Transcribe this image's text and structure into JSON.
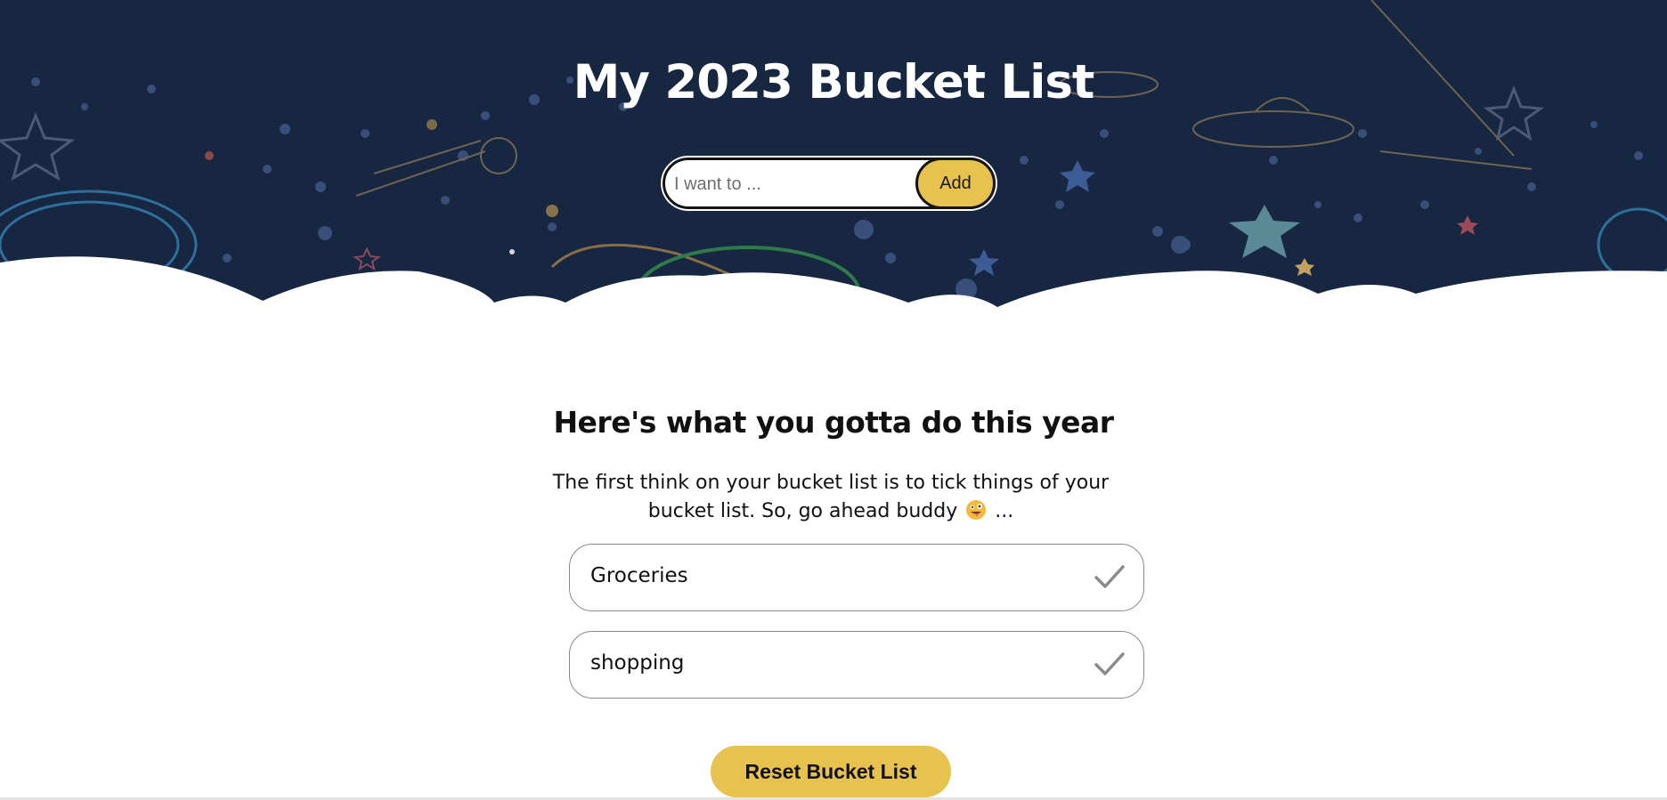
{
  "header": {
    "title": "My 2023 Bucket List"
  },
  "add_form": {
    "placeholder": "I want to ...",
    "value": "",
    "add_label": "Add"
  },
  "main": {
    "heading": "Here's what you gotta do this year",
    "intro_line1": "The first think on your bucket list is to tick things of your",
    "intro_line2_before": "bucket list. So, go ahead buddy",
    "intro_emoji": "zany-face-emoji",
    "intro_line2_after": "...",
    "items": [
      {
        "label": "Groceries",
        "icon": "checkmark-icon"
      },
      {
        "label": "shopping",
        "icon": "checkmark-icon"
      }
    ],
    "reset_label": "Reset Bucket List"
  },
  "colors": {
    "hero_bg": "#172641",
    "accent": "#e8c24e",
    "text": "#111111"
  }
}
